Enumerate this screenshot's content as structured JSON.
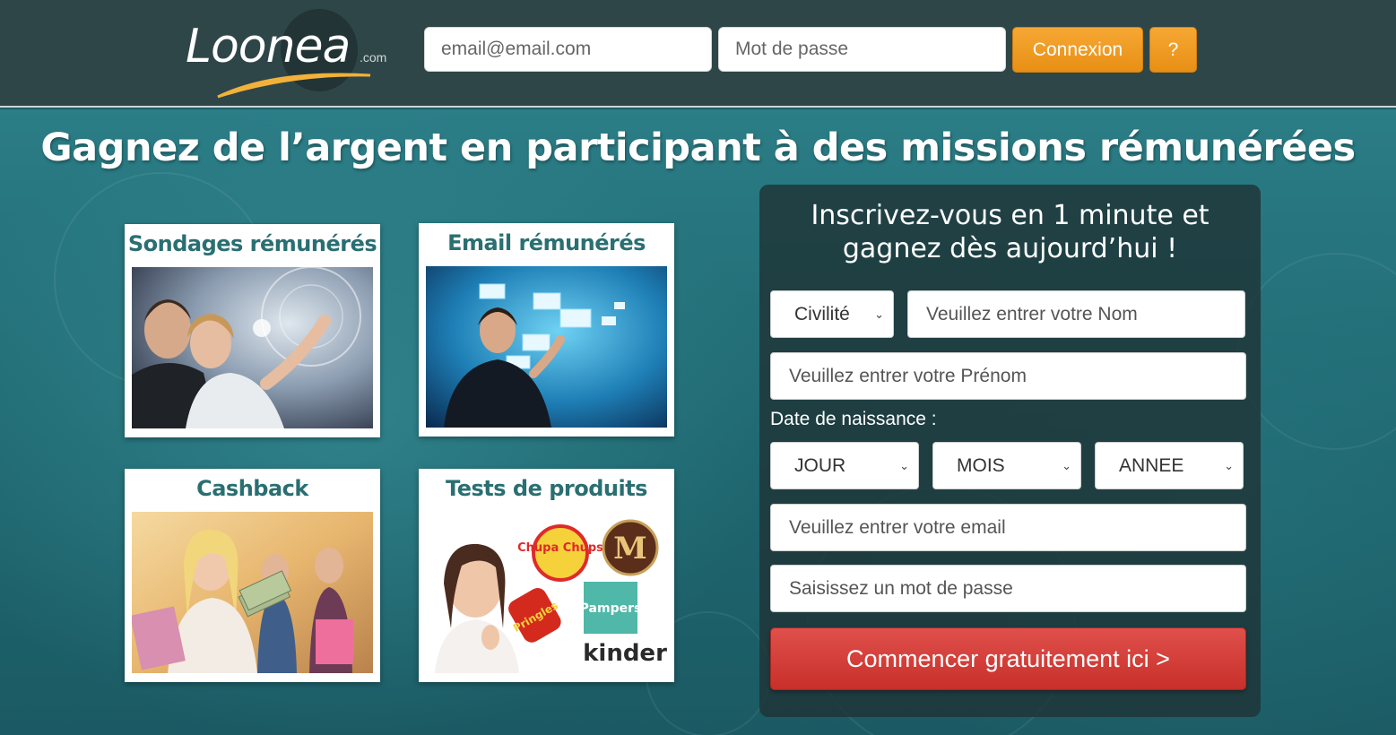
{
  "header": {
    "logo_text": "Loonea",
    "logo_suffix": ".com",
    "email_placeholder": "email@email.com",
    "password_placeholder": "Mot de passe",
    "login_label": "Connexion",
    "help_label": "?"
  },
  "hero": {
    "headline": "Gagnez de l’argent en participant à des missions rémunérées"
  },
  "cards": [
    {
      "title": "Sondages rémunérés"
    },
    {
      "title": "Email rémunérés"
    },
    {
      "title": "Cashback"
    },
    {
      "title": "Tests de produits"
    }
  ],
  "product_logos": {
    "chupa": "Chupa Chups",
    "magnum": "M",
    "pringles": "Pringles",
    "pampers": "Pampers",
    "kinder": "kinder"
  },
  "signup": {
    "title_line1": "Inscrivez-vous en 1 minute et",
    "title_line2": "gagnez dès aujourd’hui !",
    "civility": "Civilité",
    "last_name_placeholder": "Veuillez entrer votre Nom",
    "first_name_placeholder": "Veuillez entrer votre Prénom",
    "birth_label": "Date de naissance :",
    "day": "JOUR",
    "month": "MOIS",
    "year": "ANNEE",
    "email_placeholder": "Veuillez entrer votre email",
    "password_placeholder": "Saisissez un mot de passe",
    "submit_label": "Commencer gratuitement ici >"
  }
}
